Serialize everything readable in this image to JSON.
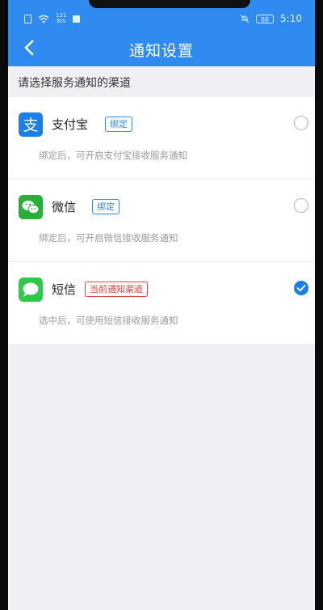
{
  "status_bar": {
    "net_speed_value": "121",
    "net_speed_unit": "B/s",
    "battery": "88",
    "time": "5:10"
  },
  "nav": {
    "title": "通知设置"
  },
  "section_header": "请选择服务通知的渠道",
  "channels": [
    {
      "name": "支付宝",
      "tag": "绑定",
      "description": "绑定后，可开启支付宝接收服务通知",
      "selected": false,
      "icon": "alipay-icon",
      "icon_color": "#1a7fe8"
    },
    {
      "name": "微信",
      "tag": "绑定",
      "description": "绑定后，可开启微信接收服务通知",
      "selected": false,
      "icon": "wechat-icon",
      "icon_color": "#2aae3a"
    },
    {
      "name": "短信",
      "tag": "当前通知渠道",
      "description": "选中后，可使用短信接收服务通知",
      "selected": true,
      "icon": "sms-icon",
      "icon_color": "#2ec84a"
    }
  ],
  "colors": {
    "primary": "#2f8bf0",
    "selected_tag": "#e64340",
    "background": "#efeff4"
  }
}
